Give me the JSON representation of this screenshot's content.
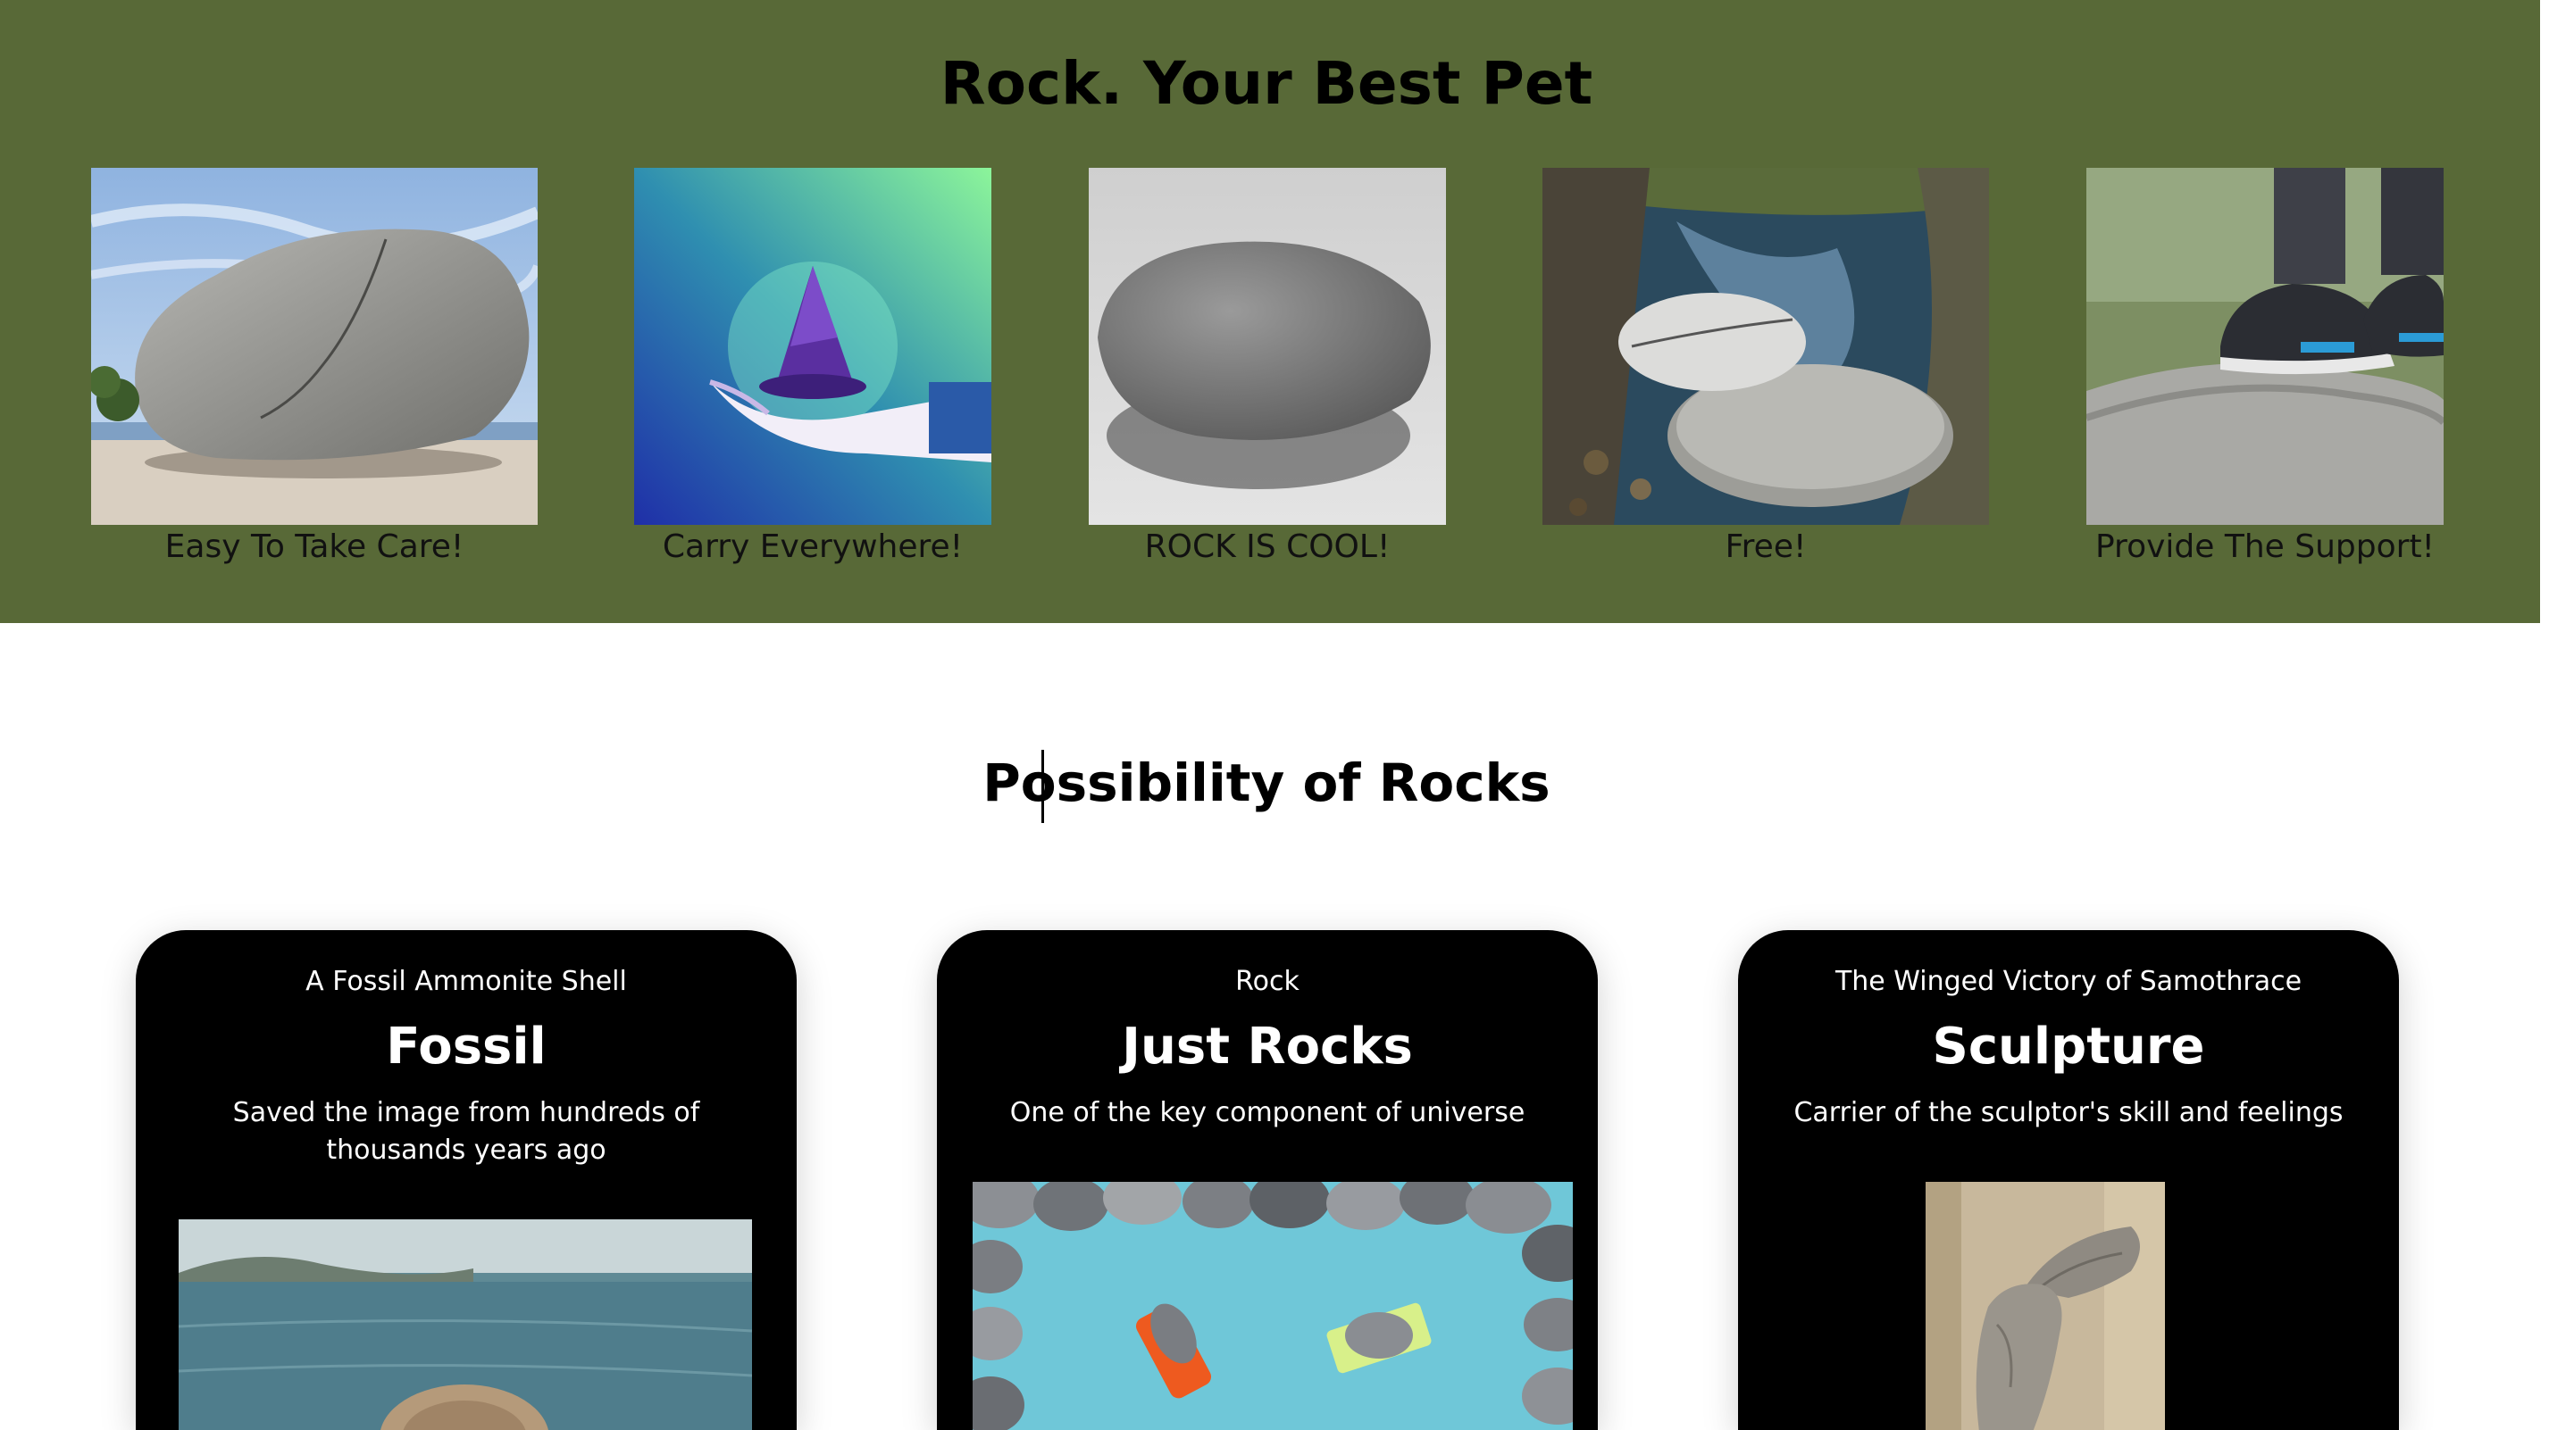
{
  "header": {
    "title": "Rock. Your Best Pet"
  },
  "features": [
    {
      "caption": "Easy To Take Care!",
      "image": "boulder-on-beach"
    },
    {
      "caption": "Carry Everywhere!",
      "image": "hand-holding-stones-illustration"
    },
    {
      "caption": "ROCK IS COOL!",
      "image": "grey-pebble"
    },
    {
      "caption": "Free!",
      "image": "stone-in-stream"
    },
    {
      "caption": "Provide The Support!",
      "image": "sneakers-on-rock"
    }
  ],
  "section": {
    "title": "Possibility of Rocks"
  },
  "cards": [
    {
      "kicker": "A Fossil Ammonite Shell",
      "title": "Fossil",
      "description": "Saved the image from hundreds of thousands years ago",
      "image": "ammonite-by-sea"
    },
    {
      "kicker": "Rock",
      "title": "Just Rocks",
      "description": "One of the key component of universe",
      "image": "pebbles-on-blue"
    },
    {
      "kicker": "The Winged Victory of Samothrace",
      "title": "Sculpture",
      "description": "Carrier of the sculptor's skill and feelings",
      "image": "winged-victory-statue"
    }
  ],
  "colors": {
    "band": "#586937",
    "card": "#000000"
  }
}
